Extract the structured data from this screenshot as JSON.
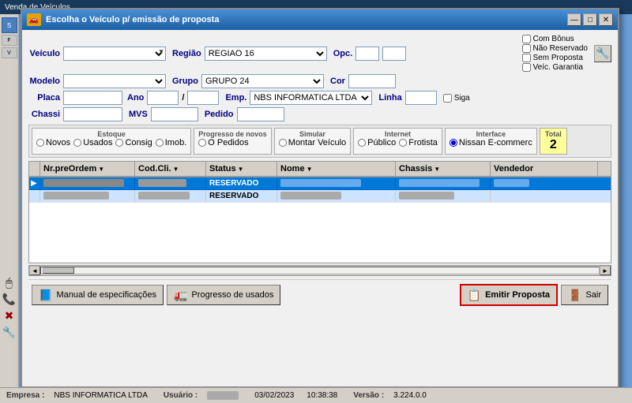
{
  "app": {
    "title": "Venda de Veículos",
    "dialog_title": "Escolha o Veículo p/ emissão de proposta"
  },
  "sidebar_items": [
    "Sim",
    "Flux",
    "Ve"
  ],
  "form": {
    "veiculo_label": "Veículo",
    "modelo_label": "Modelo",
    "placa_label": "Placa",
    "ano_label": "Ano",
    "chassi_label": "Chassi",
    "regiao_label": "Região",
    "grupo_label": "Grupo",
    "emp_label": "Emp.",
    "mvs_label": "MVS",
    "opc_label": "Opc.",
    "cor_label": "Cor",
    "linha_label": "Linha",
    "pedido_label": "Pedido",
    "siga_label": "Siga",
    "regiao_value": "REGIAO 16",
    "grupo_value": "GRUPO 24",
    "emp_value": "NBS INFORMATICA LTDA",
    "com_bonus": "Com Bônus",
    "nao_reservado": "Não Reservado",
    "sem_proposta": "Sem Proposta",
    "veic_garantia": "Veíc. Garantia"
  },
  "filter_groups": {
    "estoque_label": "Estoque",
    "estoque_options": [
      "Novos",
      "Usados",
      "Consig",
      "Imob."
    ],
    "progress_label": "Progresso de novos",
    "progress_options": [
      "O Pedidos"
    ],
    "simulate_label": "Simular",
    "simulate_options": [
      "Montar Veículo"
    ],
    "internet_label": "Internet",
    "internet_options": [
      "Público",
      "Frotista"
    ],
    "interface_label": "Interface",
    "interface_options": [
      "Nissan E-commerc"
    ],
    "interface_selected": "Nissan E-commerc",
    "total_label": "Total",
    "total_value": "2"
  },
  "table": {
    "columns": [
      "Nr.preOrdem",
      "Cod.Cli.",
      "Status",
      "Nome",
      "Chassis",
      "Vendedor"
    ],
    "rows": [
      {
        "nr": "████████████",
        "cod": "████████14",
        "status": "RESERVADO",
        "nome": "████████████████",
        "chassis": "███████████████",
        "vendedor": "███████",
        "selected": true
      },
      {
        "nr": "█████████████",
        "cod": "████████113",
        "status": "RESERVADO",
        "nome": "████████████",
        "chassis": "███████████",
        "vendedor": "",
        "selected": false
      }
    ]
  },
  "actions": {
    "manual_label": "Manual de especificações",
    "progresso_label": "Progresso de usados",
    "emitir_label": "Emitir Proposta",
    "sair_label": "Sair"
  },
  "statusbar": {
    "empresa_label": "Empresa :",
    "empresa_value": "NBS INFORMATICA LTDA",
    "usuario_label": "Usuário :",
    "usuario_value": "████",
    "date_value": "03/02/2023",
    "time_value": "10:38:38",
    "versao_label": "Versão :",
    "versao_value": "3.224.0.0"
  },
  "title_buttons": {
    "minimize": "—",
    "maximize": "□",
    "close": "✕"
  }
}
